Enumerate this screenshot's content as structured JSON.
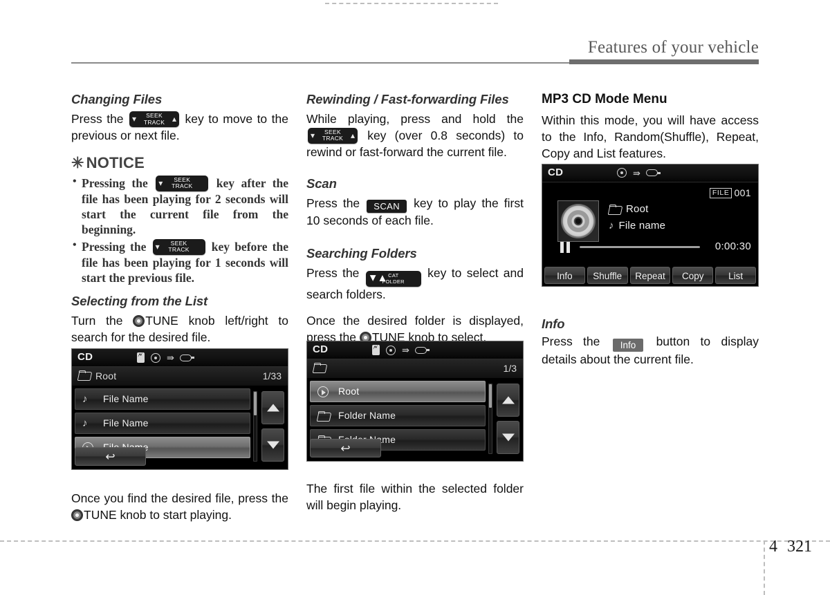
{
  "header": {
    "title": "Features of your vehicle"
  },
  "footer": {
    "chapter": "4",
    "page": "321"
  },
  "col1": {
    "changing_files": {
      "heading": "Changing Files",
      "text_before": "Press the",
      "key": {
        "top": "SEEK",
        "bottom": "TRACK"
      },
      "text_after": "key to move to the previous or next file."
    },
    "notice": {
      "title": "NOTICE",
      "asterisk": "✳",
      "items": [
        {
          "before": "Pressing the",
          "key": {
            "top": "SEEK",
            "bottom": "TRACK"
          },
          "after": "key after the file has been playing for 2 seconds will start the current file from the beginning."
        },
        {
          "before": "Pressing the",
          "key": {
            "top": "SEEK",
            "bottom": "TRACK"
          },
          "after": "key before the file has been playing for 1 seconds will start the previous file."
        }
      ]
    },
    "selecting_from_list": {
      "heading": "Selecting from the List",
      "text_before": "Turn the",
      "knob_label": "TUNE",
      "text_after": "knob left/right to search for the desired file."
    },
    "screen": {
      "source": "CD",
      "status_icons": [
        "bluetooth-icon",
        "disc-icon",
        "usb-icon",
        "aux-icon"
      ],
      "folder": "Root",
      "page": "1/33",
      "rows": [
        {
          "icon": "music-note-icon",
          "label": "File Name",
          "selected": false
        },
        {
          "icon": "music-note-icon",
          "label": "File Name",
          "selected": false
        },
        {
          "icon": "play-circle-icon",
          "label": "File Name",
          "selected": true
        }
      ],
      "back_button": "↩"
    },
    "after_text_before": "Once you find the desired file, press the",
    "after_knob_label": "TUNE",
    "after_text_after": "knob to start playing."
  },
  "col2": {
    "rewinding": {
      "heading": "Rewinding / Fast-forwarding Files",
      "text_before": "While playing, press and hold the",
      "key": {
        "top": "SEEK",
        "bottom": "TRACK"
      },
      "text_after": "key (over 0.8 seconds) to rewind or fast-forward the current file."
    },
    "scan": {
      "heading": "Scan",
      "text_before": "Press the",
      "key_label": "SCAN",
      "text_after": "key to play the first 10 seconds of each file."
    },
    "searching_folders": {
      "heading": "Searching Folders",
      "text_before": "Press the",
      "key": {
        "top": "CAT",
        "bottom": "FOLDER"
      },
      "text_after": "key to select and search folders.",
      "line2_before": "Once the desired folder is displayed, press the",
      "line2_knob": "TUNE",
      "line2_after": "knob to select."
    },
    "screen": {
      "source": "CD",
      "status_icons": [
        "bluetooth-icon",
        "disc-icon",
        "usb-icon",
        "aux-icon"
      ],
      "folder": "",
      "page": "1/3",
      "rows": [
        {
          "icon": "play-circle-icon",
          "label": "Root",
          "selected": true
        },
        {
          "icon": "folder-icon",
          "label": "Folder Name",
          "selected": false
        },
        {
          "icon": "folder-icon",
          "label": "Folder Name",
          "selected": false
        }
      ],
      "back_button": "↩"
    },
    "after_text": "The first file within the selected folder will begin playing."
  },
  "col3": {
    "mp3_menu": {
      "heading": "MP3 CD Mode Menu",
      "text": "Within this mode, you will have access to the Info, Random(Shuffle), Repeat, Copy and List features."
    },
    "screen": {
      "source": "CD",
      "status_icons": [
        "disc-icon",
        "usb-icon",
        "aux-icon"
      ],
      "file_label": "FILE",
      "file_number": "001",
      "folder": "Root",
      "file_name": "File name",
      "time": "0:00:30",
      "transport_state": "paused",
      "soft_buttons": [
        "Info",
        "Shuffle",
        "Repeat",
        "Copy",
        "List"
      ]
    },
    "info": {
      "heading": "Info",
      "text_before": "Press the",
      "button_label": "Info",
      "text_after": "button to display details about the current file."
    }
  },
  "colors": {
    "header_rule": "#6e6e6e",
    "screen_bg": "#000000",
    "screen_text": "#f0f0f0",
    "notice_text": "#333333"
  }
}
